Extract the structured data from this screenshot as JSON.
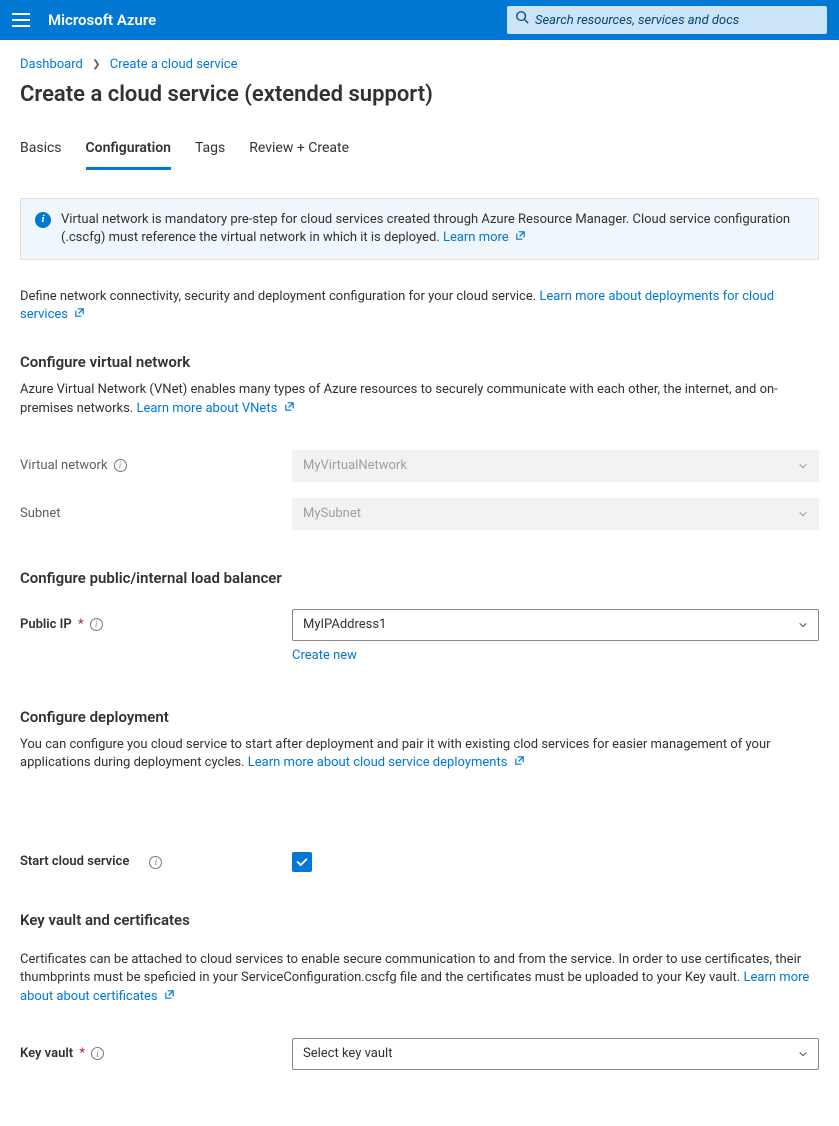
{
  "header": {
    "brand": "Microsoft Azure",
    "search_placeholder": "Search resources, services and docs"
  },
  "breadcrumb": {
    "item1": "Dashboard",
    "item2": "Create a cloud service"
  },
  "page_title": "Create a cloud service (extended support)",
  "tabs": {
    "basics": "Basics",
    "configuration": "Configuration",
    "tags": "Tags",
    "review": "Review + Create"
  },
  "infobox": {
    "text": "Virtual network is mandatory pre-step for cloud services created through Azure Resource Manager. Cloud service configuration (.cscfg) must reference the virtual network in which it is deployed. ",
    "learn_more": "Learn more"
  },
  "intro": {
    "text": "Define network connectivity, security and deployment configuration for your cloud service. ",
    "link": "Learn more about deployments for cloud services"
  },
  "vnet_section": {
    "heading": "Configure virtual network",
    "desc": "Azure Virtual Network (VNet) enables many types of Azure resources to securely communicate with each other, the internet, and on-premises networks. ",
    "link": "Learn more about VNets",
    "vnet_label": "Virtual network",
    "vnet_value": "MyVirtualNetwork",
    "subnet_label": "Subnet",
    "subnet_value": "MySubnet"
  },
  "lb_section": {
    "heading": "Configure public/internal load balancer",
    "pubip_label": "Public IP",
    "pubip_value": "MyIPAddress1",
    "create_new": "Create new"
  },
  "deploy_section": {
    "heading": "Configure deployment",
    "desc": "You can configure you cloud service to start after deployment and pair it with existing clod services for easier management of your applications during deployment cycles. ",
    "link": "Learn more about cloud service deployments",
    "start_label": "Start cloud service"
  },
  "kv_section": {
    "heading": "Key vault and certificates",
    "desc": "Certificates can be attached to cloud services to enable secure communication to and from the service. In order to use certificates, their thumbprints must be speficied in your ServiceConfiguration.cscfg file and the certificates must be uploaded to your Key vault. ",
    "link": "Learn more about about certificates",
    "kv_label": "Key vault",
    "kv_value": "Select key vault"
  }
}
